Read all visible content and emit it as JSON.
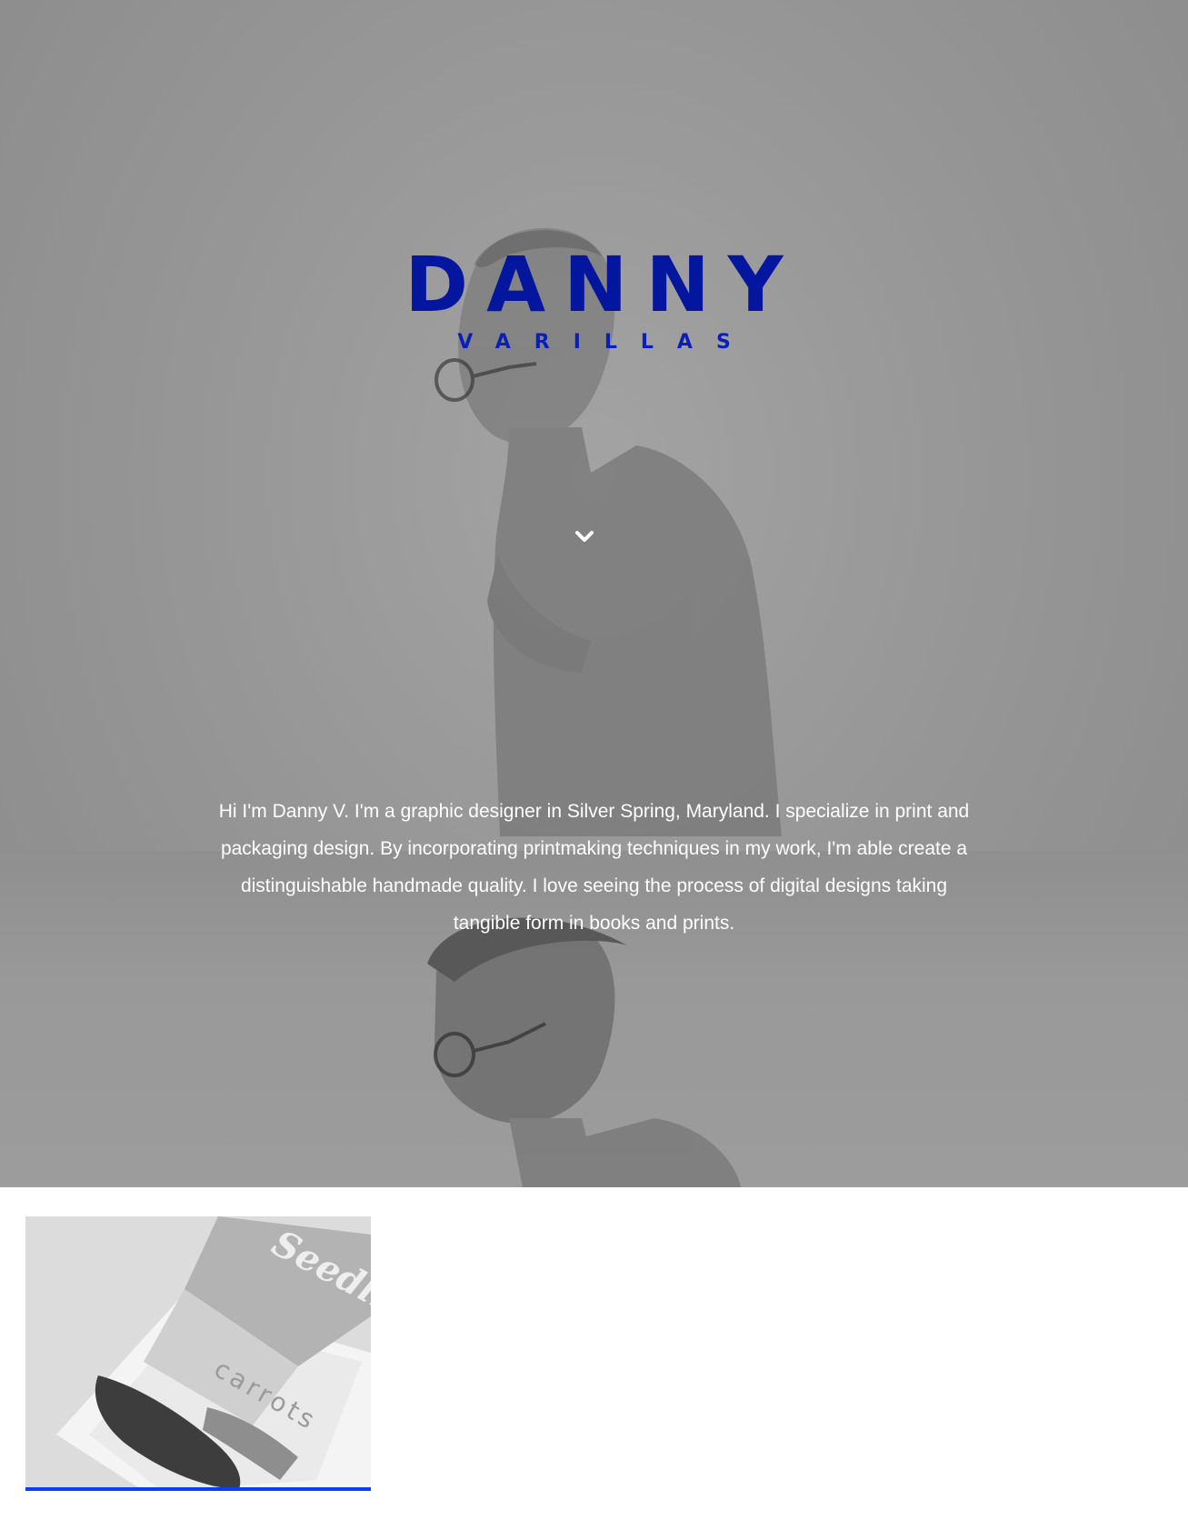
{
  "hero": {
    "first_name": "DANNY",
    "last_name": "VARILLAS",
    "intro": "Hi I'm Danny V. I'm a graphic designer in Silver Spring, Maryland. I specialize in print and packaging design. By incorporating printmaking techniques in my work, I'm able create a distinguishable handmade quality. I love seeing the process of digital designs taking tangible form in books and prints.",
    "scroll_icon": "chevron-down-icon"
  },
  "projects": [
    {
      "brand_text": "Seedlings",
      "tag_text": "carrots"
    }
  ],
  "colors": {
    "accent": "#04169e",
    "underline": "#0d3ef5",
    "hero_background": "#959595"
  }
}
